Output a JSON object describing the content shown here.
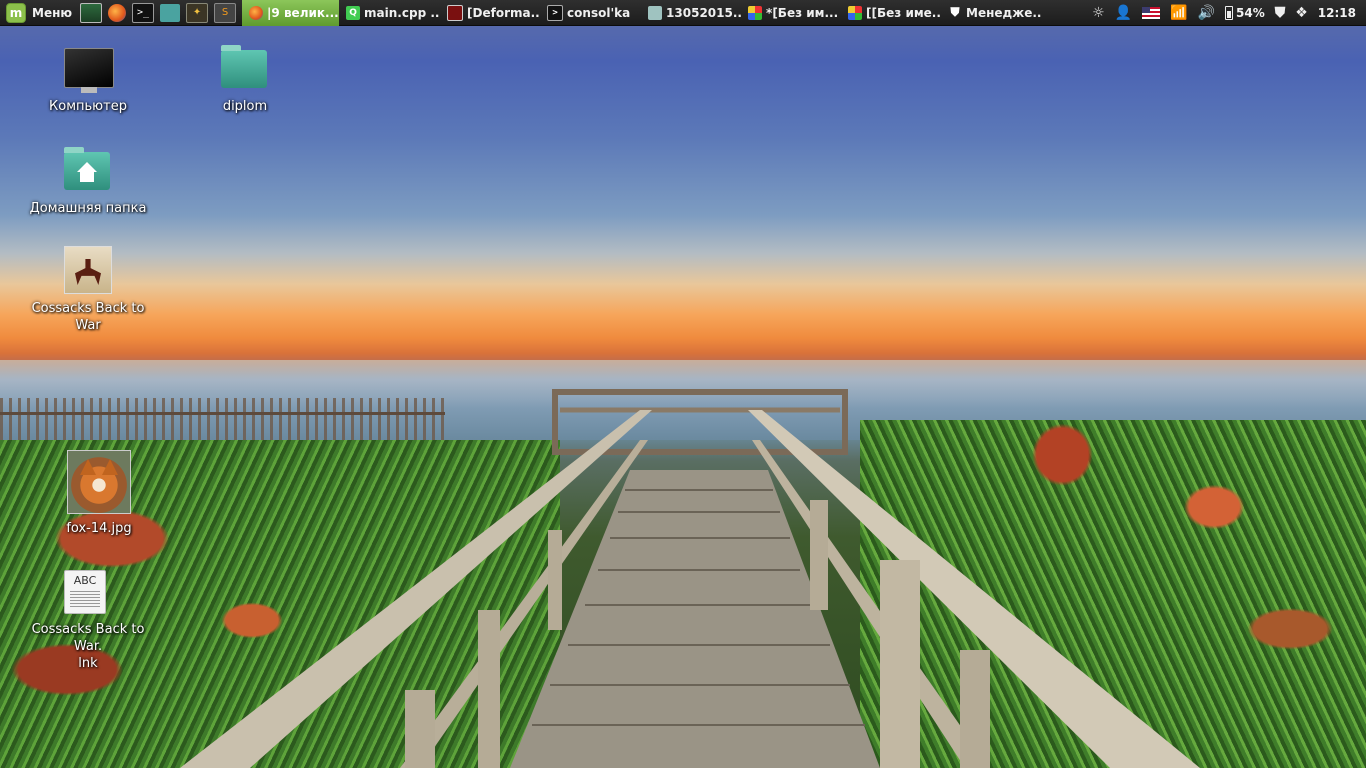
{
  "panel": {
    "menu_label": "Меню",
    "menu_logo_glyph": "m",
    "launchers": [
      {
        "name": "show-desktop",
        "icon": "monitor-icon"
      },
      {
        "name": "firefox",
        "icon": "firefox-icon"
      },
      {
        "name": "terminal",
        "icon": "terminal-icon",
        "glyph": ">_"
      },
      {
        "name": "files",
        "icon": "folder-icon"
      },
      {
        "name": "gimp",
        "icon": "gimp-icon",
        "glyph": "✦"
      },
      {
        "name": "sublime",
        "icon": "sublime-icon",
        "glyph": "S"
      }
    ],
    "tasks": [
      {
        "label": "|9 велик...",
        "icon": "firefox-icon",
        "active": true
      },
      {
        "label": "main.cpp ...",
        "icon": "qt-creator-icon",
        "glyph": "Q",
        "active": false
      },
      {
        "label": "[Deforma...",
        "icon": "app-window-icon",
        "active": false
      },
      {
        "label": "consol'ka",
        "icon": "terminal-icon",
        "glyph": ">",
        "active": false
      },
      {
        "label": "13052015...",
        "icon": "folder-icon",
        "active": false
      },
      {
        "label": "*[Без им...",
        "icon": "paint-icon",
        "active": false
      },
      {
        "label": "[[Без име...",
        "icon": "paint-icon",
        "active": false
      },
      {
        "label": "Менедже...",
        "icon": "shield-icon",
        "glyph": "⛊",
        "active": false
      }
    ],
    "tray": {
      "brightness_glyph": "☼",
      "user_glyph": "👤",
      "wifi_glyph": "📶",
      "volume_glyph": "🔊",
      "battery_percent": "54%",
      "shield_glyph": "⛊",
      "dropbox_glyph": "❖",
      "clock": "12:18"
    },
    "colors": {
      "panel_bg": "#1f1f1f",
      "active_task": "#7ab648"
    }
  },
  "desktop_icons": {
    "computer": {
      "label": "Компьютер",
      "icon": "computer-icon"
    },
    "diplom": {
      "label": "diplom",
      "icon": "folder-icon"
    },
    "home": {
      "label": "Домашняя папка",
      "icon": "home-folder-icon"
    },
    "cossacks": {
      "label": "Cossacks Back to War",
      "icon": "cossacks-game-icon"
    },
    "fox": {
      "label": "fox-14.jpg",
      "icon": "image-thumbnail-icon"
    },
    "cossacks_lnk": {
      "label": "Cossacks Back to War.\nlnk",
      "icon": "text-document-icon",
      "glyph": "ABC"
    }
  }
}
